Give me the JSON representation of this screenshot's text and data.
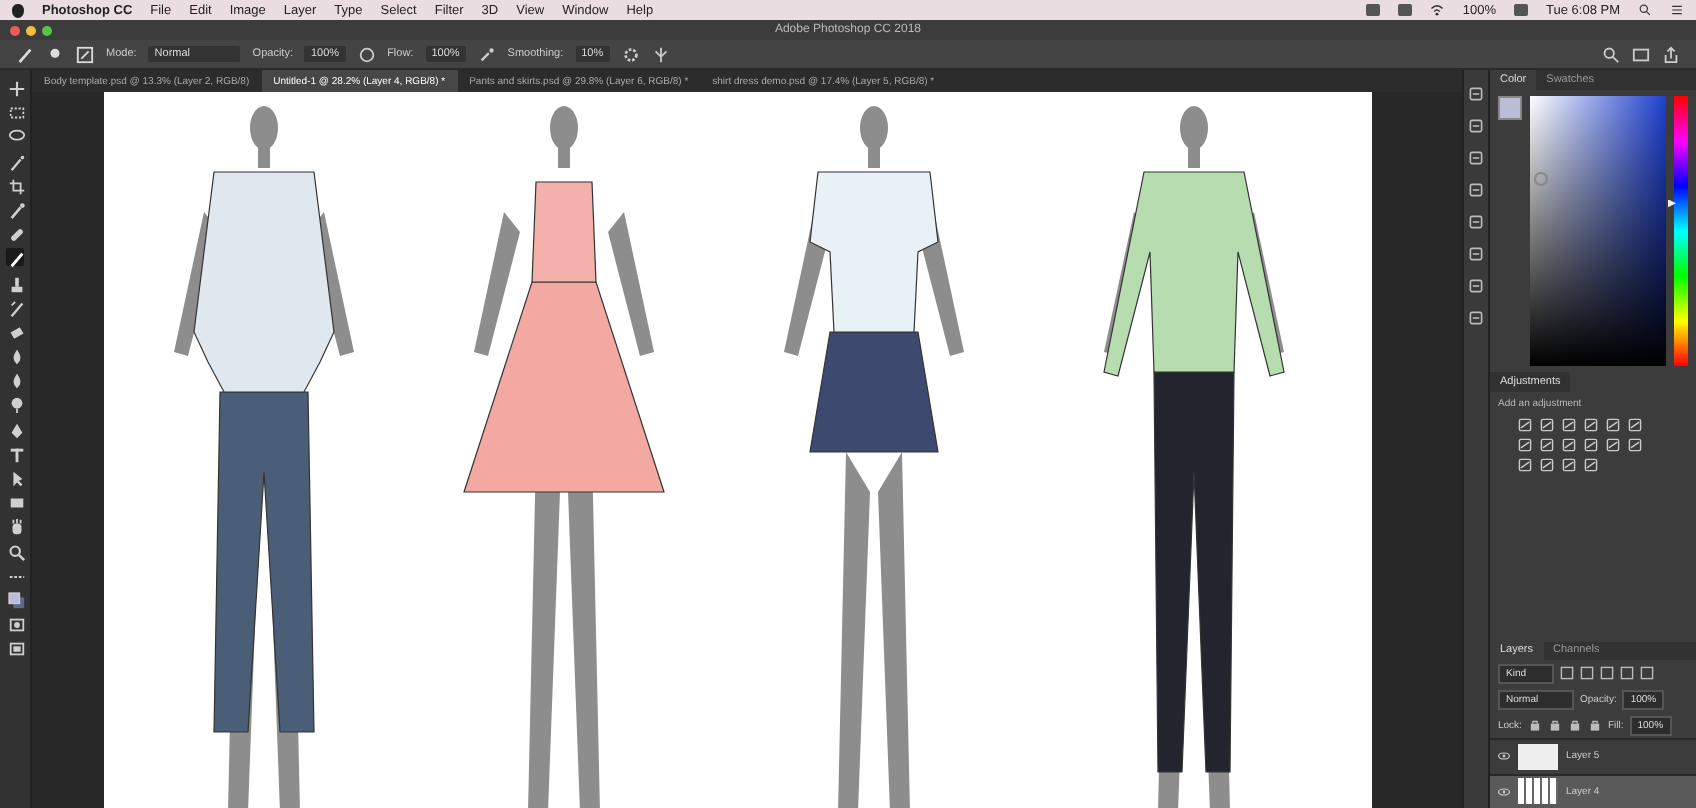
{
  "menu_bar": {
    "items": [
      "Photoshop CC",
      "File",
      "Edit",
      "Image",
      "Layer",
      "Type",
      "Select",
      "Filter",
      "3D",
      "View",
      "Window",
      "Help"
    ],
    "battery": "100%",
    "clock": "Tue 6:08 PM"
  },
  "window": {
    "title": "Adobe Photoshop CC 2018"
  },
  "options_bar": {
    "mode_label": "Mode:",
    "mode": "Normal",
    "opacity_label": "Opacity:",
    "opacity": "100%",
    "flow_label": "Flow:",
    "flow": "100%",
    "smoothing_label": "Smoothing:",
    "smoothing": "10%"
  },
  "tools": [
    {
      "kind": "move",
      "selected": false
    },
    {
      "kind": "marquee",
      "selected": false
    },
    {
      "kind": "lasso",
      "selected": false
    },
    {
      "kind": "wand",
      "selected": false
    },
    {
      "kind": "crop",
      "selected": false
    },
    {
      "kind": "eyedropper",
      "selected": false
    },
    {
      "kind": "healing",
      "selected": false
    },
    {
      "kind": "brush",
      "selected": true
    },
    {
      "kind": "stamp",
      "selected": false
    },
    {
      "kind": "history",
      "selected": false
    },
    {
      "kind": "eraser",
      "selected": false
    },
    {
      "kind": "gradient",
      "selected": false
    },
    {
      "kind": "blur",
      "selected": false
    },
    {
      "kind": "dodge",
      "selected": false
    },
    {
      "kind": "pen",
      "selected": false
    },
    {
      "kind": "type",
      "selected": false
    },
    {
      "kind": "path",
      "selected": false
    },
    {
      "kind": "shape",
      "selected": false
    },
    {
      "kind": "hand",
      "selected": false
    },
    {
      "kind": "zoom",
      "selected": false
    },
    {
      "kind": "more",
      "selected": false
    },
    {
      "kind": "colors",
      "selected": false
    },
    {
      "kind": "mask",
      "selected": false
    },
    {
      "kind": "screen",
      "selected": false
    }
  ],
  "tabs": [
    {
      "label": "Body template.psd @ 13.3% (Layer 2, RGB/8)",
      "selected": false
    },
    {
      "label": "Untitled-1 @ 28.2% (Layer 4, RGB/8) *",
      "selected": true
    },
    {
      "label": "Pants and skirts.psd @ 29.8% (Layer 6, RGB/8) *",
      "selected": false
    },
    {
      "label": "shirt dress demo.psd @ 17.4% (Layer 5, RGB/8) *",
      "selected": false
    }
  ],
  "color_panel": {
    "hue": {
      "level": 0.6
    },
    "tabs": [
      {
        "label": "Color",
        "selected": true
      },
      {
        "label": "Swatches",
        "selected": false
      }
    ]
  },
  "adjustments_panel": {
    "title": "Adjustments",
    "hint": "Add an adjustment"
  },
  "layers_panel": {
    "tabs": [
      {
        "label": "Layers",
        "selected": true
      },
      {
        "label": "Channels",
        "selected": false
      }
    ],
    "filter": "Kind",
    "blend_mode": "Normal",
    "opacity_label": "Opacity:",
    "opacity": "100%",
    "lock_label": "Lock:",
    "fill_label": "Fill:",
    "fill": "100%",
    "layers": [
      {
        "name": "Layer 5",
        "selected": false
      },
      {
        "name": "Layer 4",
        "selected": true
      }
    ]
  }
}
